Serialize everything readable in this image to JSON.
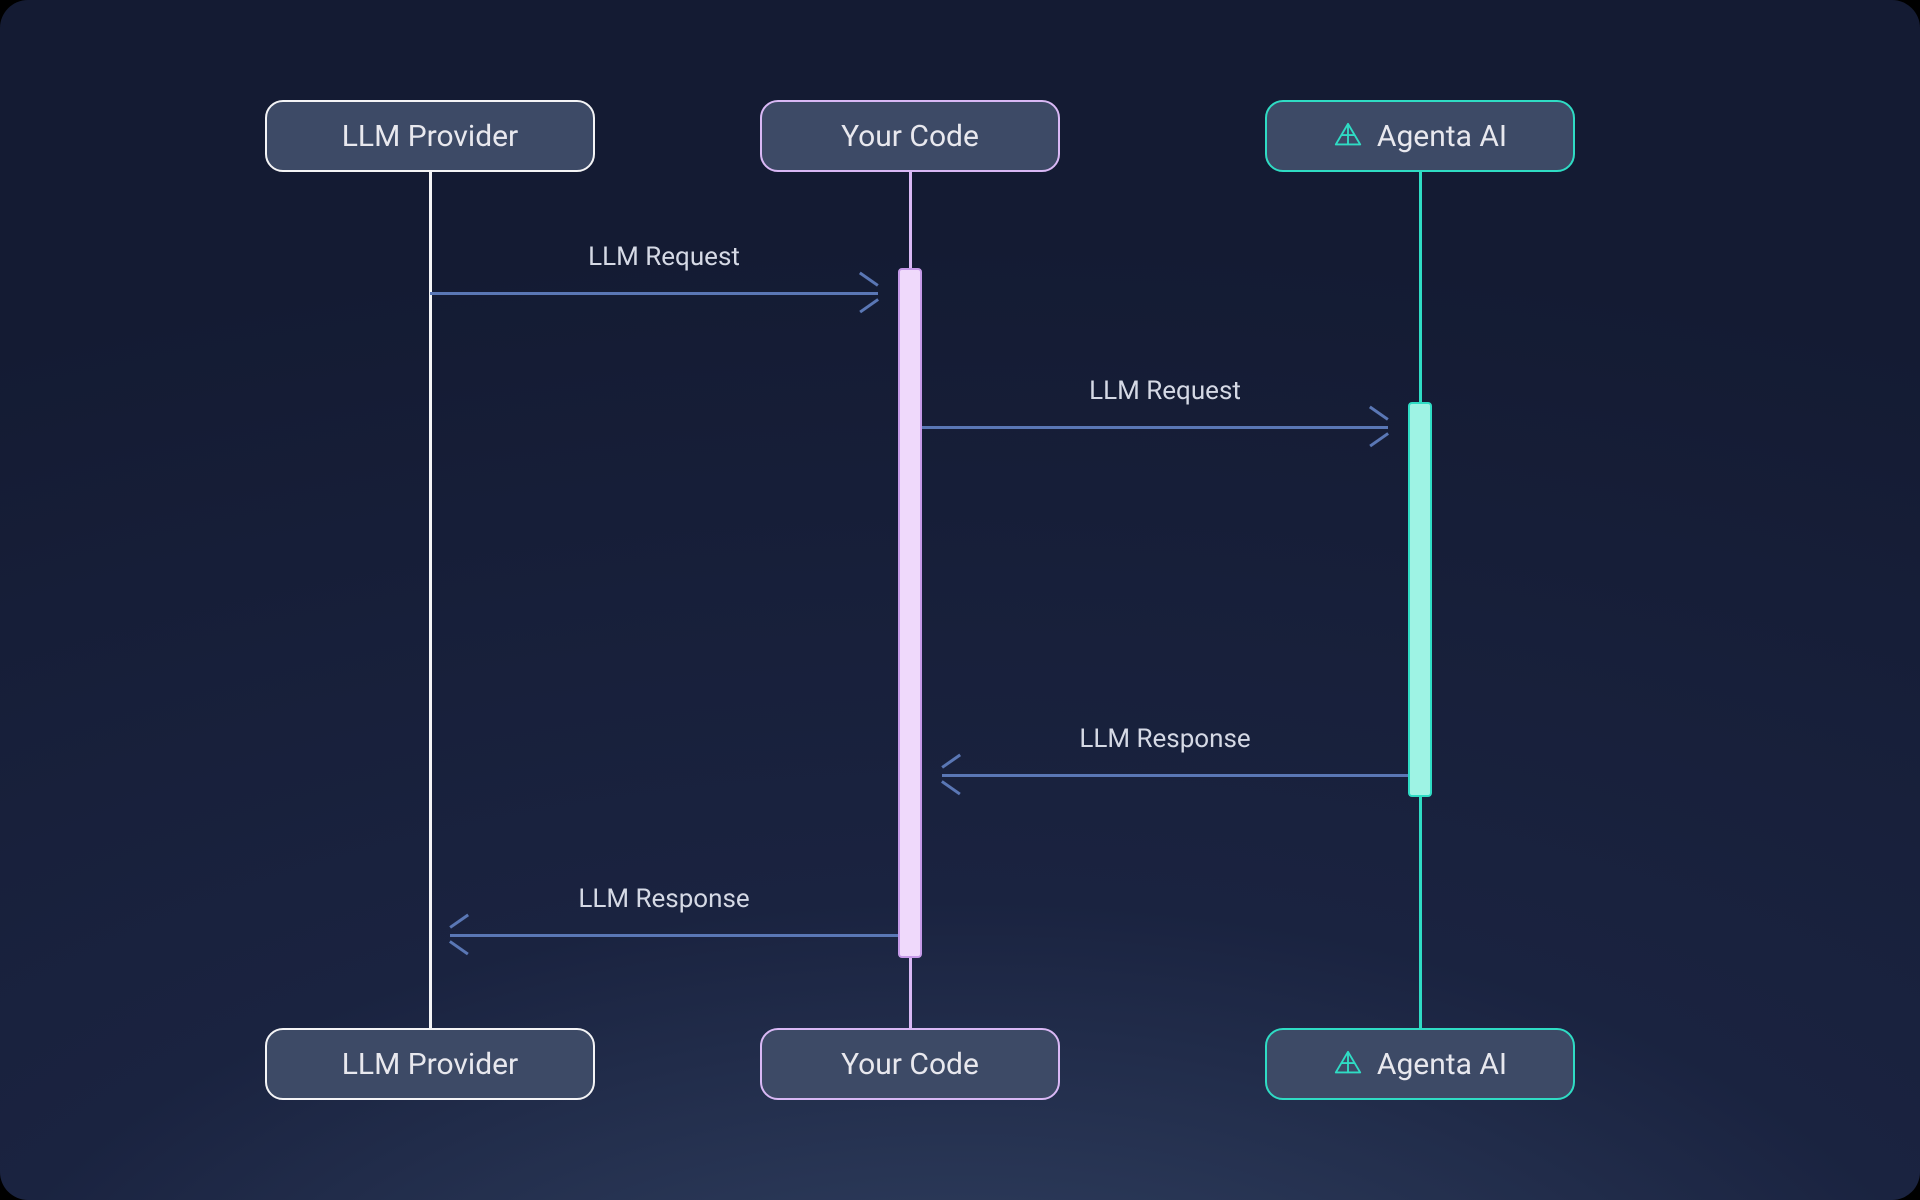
{
  "actors": {
    "llm_provider": {
      "label": "LLM Provider",
      "color": "#f4f4f6"
    },
    "your_code": {
      "label": "Your Code",
      "color": "#d9b8f5"
    },
    "agenta": {
      "label": "Agenta AI",
      "color": "#2fdcc4"
    }
  },
  "messages": {
    "m1": {
      "label": "LLM Request",
      "from": "llm_provider",
      "to": "your_code"
    },
    "m2": {
      "label": "LLM Request",
      "from": "your_code",
      "to": "agenta"
    },
    "m3": {
      "label": "LLM Response",
      "from": "agenta",
      "to": "your_code"
    },
    "m4": {
      "label": "LLM Response",
      "from": "your_code",
      "to": "llm_provider"
    }
  },
  "colors": {
    "background_top": "#141b33",
    "background_bottom": "#364768",
    "arrow": "#5a77b5",
    "box_fill": "#3d4a66",
    "text": "#e8e8ee",
    "activation_your_code_fill": "#efd9fb",
    "activation_agenta_fill": "#9ef3e4"
  }
}
